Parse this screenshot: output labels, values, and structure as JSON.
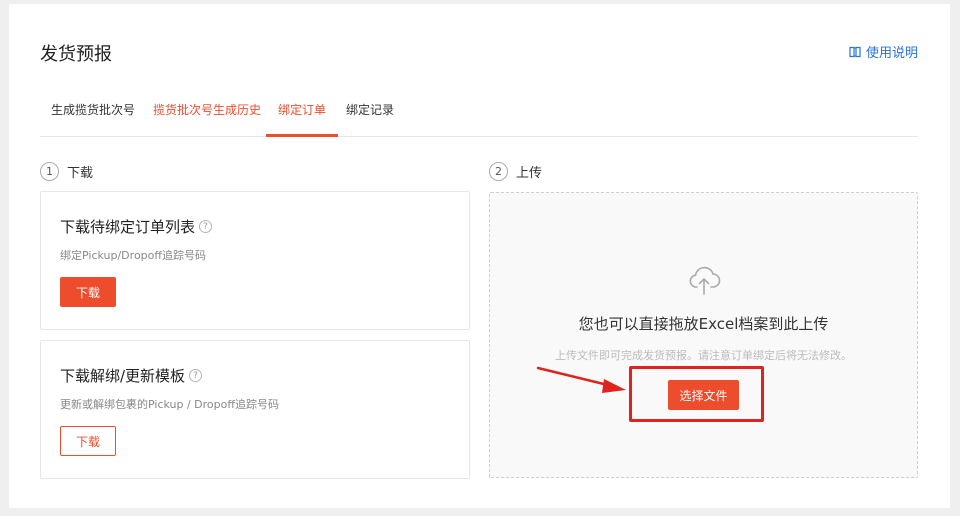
{
  "header": {
    "title": "发货预报",
    "help_label": "使用说明"
  },
  "tabs": [
    {
      "label": "生成揽货批次号",
      "state": "normal"
    },
    {
      "label": "揽货批次号生成历史",
      "state": "orange"
    },
    {
      "label": "绑定订单",
      "state": "active"
    },
    {
      "label": "绑定记录",
      "state": "normal"
    }
  ],
  "step1": {
    "number": "1",
    "label": "下载",
    "order_list": {
      "title": "下载待绑定订单列表",
      "help_icon": "?",
      "desc": "绑定Pickup/Dropoff追踪号码",
      "button": "下载"
    },
    "template": {
      "title": "下载解绑/更新模板",
      "help_icon": "?",
      "desc": "更新或解绑包裹的Pickup / Dropoff追踪号码",
      "button": "下载"
    }
  },
  "step2": {
    "number": "2",
    "label": "上传",
    "upload": {
      "title": "您也可以直接拖放Excel档案到此上传",
      "subtitle": "上传文件即可完成发货预报。请注意订单绑定后将无法修改。",
      "button": "选择文件"
    }
  },
  "colors": {
    "accent": "#ee4d2d",
    "link": "#2673dd",
    "annotation": "#e0231e"
  },
  "icons": {
    "help": "book-icon",
    "upload": "cloud-upload-icon"
  }
}
